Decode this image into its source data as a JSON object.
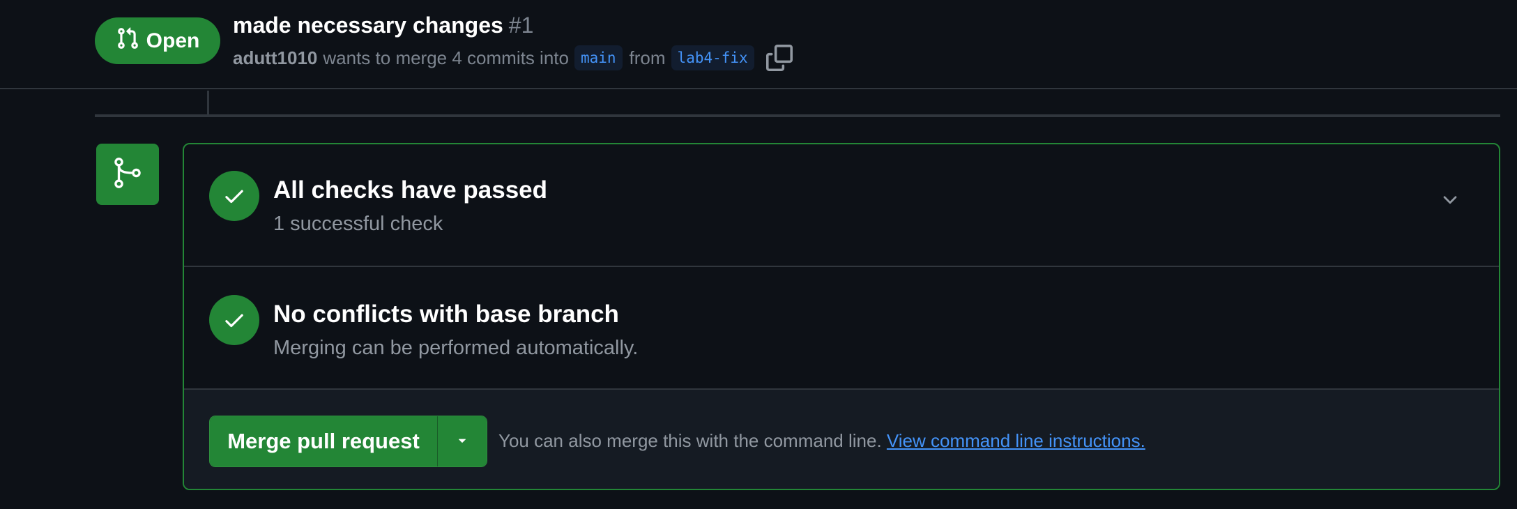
{
  "header": {
    "state_label": "Open",
    "title": "made necessary changes",
    "number": "#1",
    "author": "adutt1010",
    "meta_text_1": "wants to merge 4 commits into",
    "base_branch": "main",
    "meta_text_2": "from",
    "head_branch": "lab4-fix",
    "icons": {
      "state": "git-pull-request-icon",
      "copy": "copy-icon"
    }
  },
  "merge_box": {
    "icon": "git-merge-icon",
    "checks": {
      "title": "All checks have passed",
      "subtitle": "1 successful check",
      "icon": "check-icon",
      "toggle_icon": "chevron-down-icon"
    },
    "conflicts": {
      "title": "No conflicts with base branch",
      "subtitle": "Merging can be performed automatically.",
      "icon": "check-icon"
    },
    "actions": {
      "merge_label": "Merge pull request",
      "dropdown_icon": "triangle-down-icon",
      "hint_text": "You can also merge this with the command line.",
      "hint_link": "View command line instructions."
    }
  },
  "colors": {
    "background": "#0d1117",
    "success": "#238636",
    "border": "#30363d",
    "link": "#4493f8",
    "muted_text": "#9198a1"
  }
}
